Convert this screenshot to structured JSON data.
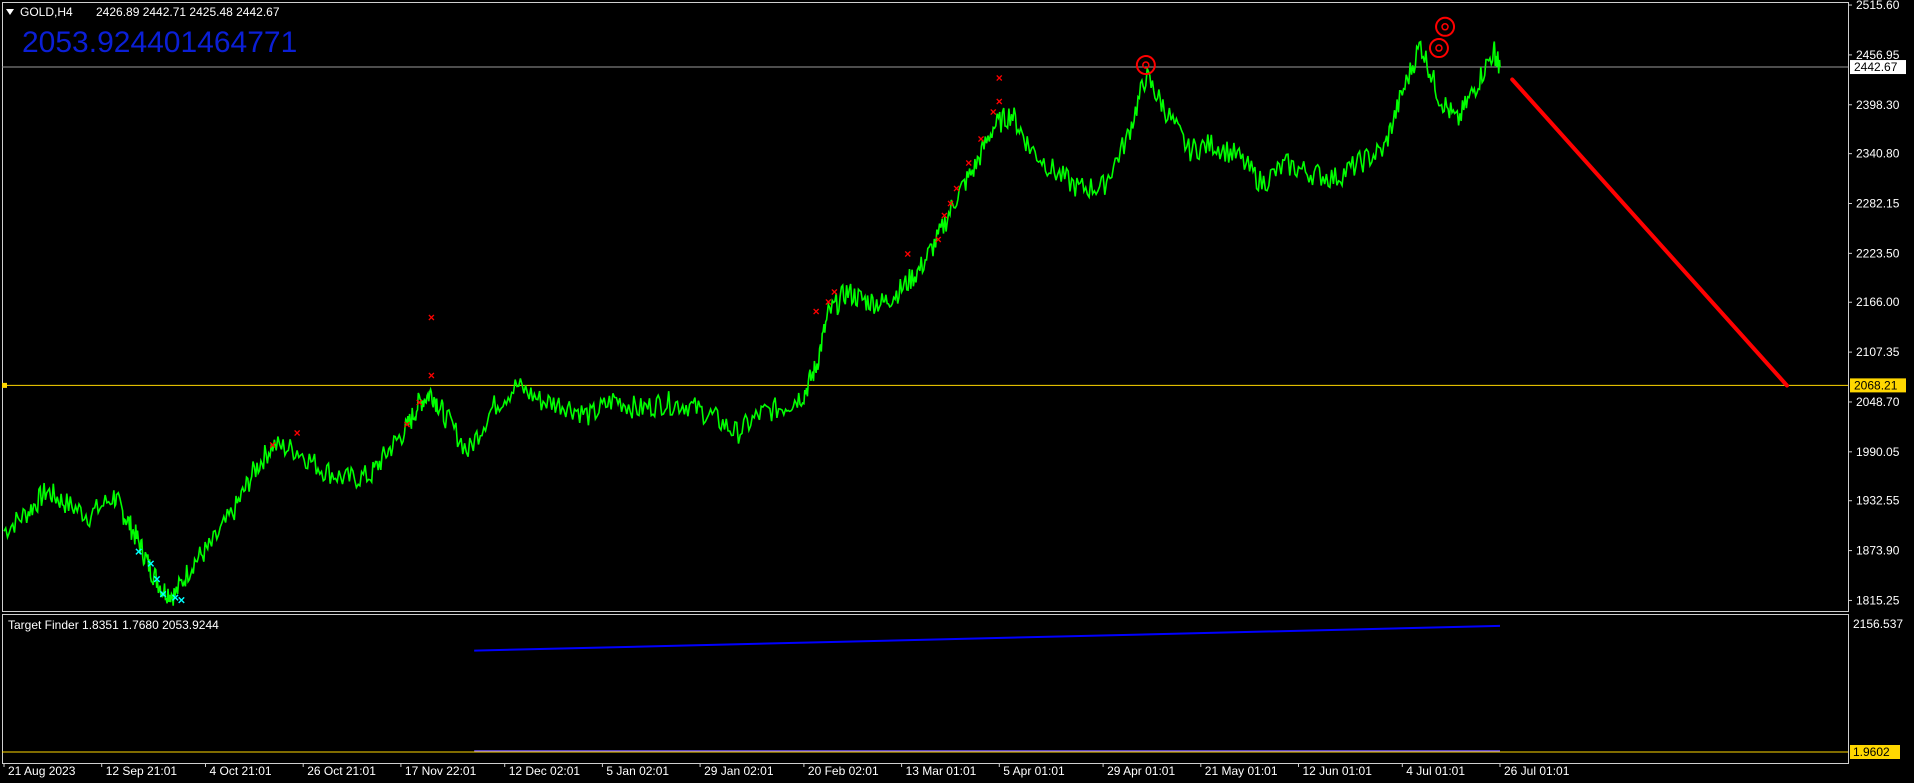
{
  "window": {
    "symbol_label": "GOLD,H4",
    "ohlc": "2426.89 2442.71 2425.48 2442.67",
    "big_value": "2053.924401464771"
  },
  "colors": {
    "background": "#000000",
    "price_line": "#00ff00",
    "sell_marker": "#ff0000",
    "buy_marker": "#00ffff",
    "support_line": "#ffd700",
    "projection": "#ff0000",
    "indicator": "#0000ff"
  },
  "chart_data": [
    {
      "type": "line",
      "name_label": "GOLD,H4",
      "y_ticks": [
        "2515.60",
        "2456.95",
        "2398.30",
        "2340.80",
        "2282.15",
        "2223.50",
        "2166.00",
        "2107.35",
        "2048.70",
        "1990.05",
        "1932.55",
        "1873.90",
        "1815.25"
      ],
      "ylim": [
        1804,
        2518
      ],
      "x_ticks": [
        "21 Aug 2023",
        "12 Sep 21:01",
        "4 Oct 21:01",
        "26 Oct 21:01",
        "17 Nov 22:01",
        "12 Dec 02:01",
        "5 Jan 02:01",
        "29 Jan 02:01",
        "20 Feb 02:01",
        "13 Mar 01:01",
        "5 Apr 01:01",
        "29 Apr 01:01",
        "21 May 01:01",
        "12 Jun 01:01",
        "4 Jul 01:01",
        "26 Jul 01:01"
      ],
      "x_positions": [
        0,
        16,
        33,
        49,
        65,
        82,
        98,
        114,
        131,
        147,
        163,
        180,
        196,
        212,
        229,
        245
      ],
      "series_points": [
        [
          0,
          1897
        ],
        [
          4,
          1920
        ],
        [
          7,
          1944
        ],
        [
          10,
          1930
        ],
        [
          14,
          1915
        ],
        [
          18,
          1938
        ],
        [
          20,
          1912
        ],
        [
          22,
          1885
        ],
        [
          24,
          1852
        ],
        [
          26,
          1828
        ],
        [
          28,
          1822
        ],
        [
          31,
          1860
        ],
        [
          34,
          1880
        ],
        [
          38,
          1925
        ],
        [
          41,
          1968
        ],
        [
          44,
          1998
        ],
        [
          48,
          1992
        ],
        [
          52,
          1970
        ],
        [
          56,
          1958
        ],
        [
          60,
          1962
        ],
        [
          63,
          1992
        ],
        [
          66,
          2018
        ],
        [
          68,
          2048
        ],
        [
          70,
          2060
        ],
        [
          72,
          2035
        ],
        [
          76,
          1990
        ],
        [
          80,
          2042
        ],
        [
          84,
          2068
        ],
        [
          88,
          2050
        ],
        [
          92,
          2045
        ],
        [
          96,
          2032
        ],
        [
          100,
          2052
        ],
        [
          104,
          2040
        ],
        [
          108,
          2048
        ],
        [
          112,
          2045
        ],
        [
          116,
          2032
        ],
        [
          120,
          2012
        ],
        [
          124,
          2035
        ],
        [
          128,
          2044
        ],
        [
          131,
          2058
        ],
        [
          133,
          2090
        ],
        [
          135,
          2152
        ],
        [
          138,
          2178
        ],
        [
          141,
          2168
        ],
        [
          144,
          2165
        ],
        [
          147,
          2182
        ],
        [
          150,
          2205
        ],
        [
          153,
          2242
        ],
        [
          156,
          2290
        ],
        [
          159,
          2325
        ],
        [
          162,
          2372
        ],
        [
          165,
          2388
        ],
        [
          168,
          2348
        ],
        [
          172,
          2320
        ],
        [
          176,
          2300
        ],
        [
          180,
          2302
        ],
        [
          184,
          2360
        ],
        [
          187,
          2432
        ],
        [
          190,
          2395
        ],
        [
          194,
          2345
        ],
        [
          198,
          2352
        ],
        [
          202,
          2338
        ],
        [
          206,
          2306
        ],
        [
          210,
          2328
        ],
        [
          214,
          2318
        ],
        [
          218,
          2312
        ],
        [
          222,
          2330
        ],
        [
          226,
          2346
        ],
        [
          229,
          2412
        ],
        [
          232,
          2470
        ],
        [
          235,
          2408
        ],
        [
          238,
          2378
        ],
        [
          241,
          2420
        ],
        [
          244,
          2462
        ],
        [
          245,
          2442
        ]
      ],
      "sell_markers": [
        [
          44,
          1998
        ],
        [
          48,
          2012
        ],
        [
          66,
          2022
        ],
        [
          68,
          2048
        ],
        [
          70,
          2080
        ],
        [
          70,
          2148
        ],
        [
          133,
          2155
        ],
        [
          135,
          2166
        ],
        [
          136,
          2178
        ],
        [
          148,
          2223
        ],
        [
          153,
          2240
        ],
        [
          154,
          2268
        ],
        [
          155,
          2282
        ],
        [
          156,
          2300
        ],
        [
          158,
          2330
        ],
        [
          160,
          2358
        ],
        [
          162,
          2390
        ],
        [
          163,
          2402
        ],
        [
          163,
          2430
        ]
      ],
      "buy_markers": [
        [
          22,
          1872
        ],
        [
          24,
          1858
        ],
        [
          25,
          1840
        ],
        [
          26,
          1822
        ],
        [
          28,
          1818
        ],
        [
          29,
          1815
        ]
      ],
      "circle_markers": [
        [
          187,
          2445
        ],
        [
          235,
          2465
        ],
        [
          236,
          2490
        ]
      ],
      "hline_value": 2068.21,
      "hline_label": "2068.21",
      "current_price_label": "2442.67",
      "current_price": 2442.67,
      "projection": [
        [
          247,
          2428
        ],
        [
          292,
          2068
        ]
      ]
    },
    {
      "type": "line",
      "name_label": "Target Finder 1.8351 1.7680 2053.9244",
      "y_ticks": [
        "2156.537"
      ],
      "bottom_label": "1.9602",
      "series": [
        {
          "name": "Target Finder",
          "points": [
            [
              77,
              0.78
            ],
            [
              245,
              0.97
            ]
          ]
        },
        {
          "points": [
            [
              77,
              0.0
            ],
            [
              245,
              0.0
            ]
          ]
        }
      ]
    }
  ]
}
